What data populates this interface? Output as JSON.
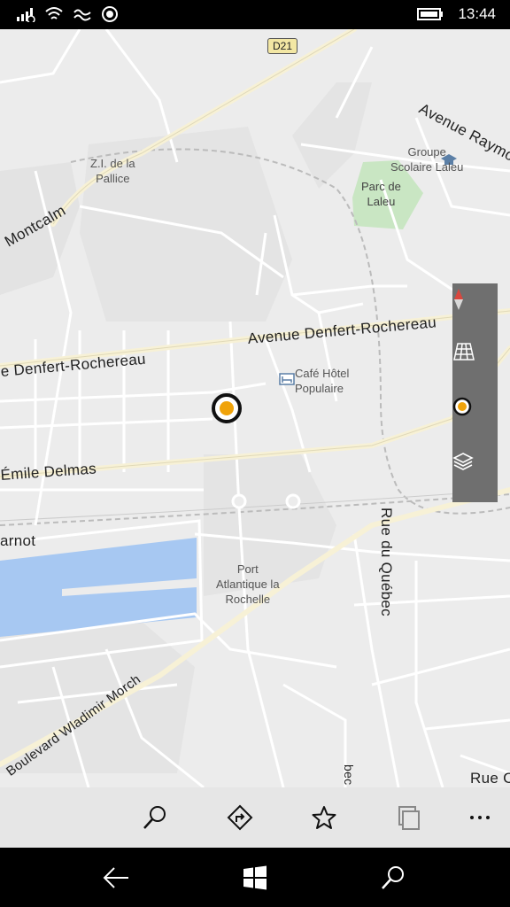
{
  "status_bar": {
    "time": "13:44",
    "icons": [
      "signal-icon",
      "wifi-icon",
      "wifi-calling-icon",
      "location-icon",
      "battery-icon"
    ]
  },
  "map": {
    "route_shield": "D21",
    "area_labels": [
      {
        "id": "zi",
        "text": "Z.I. de la\nPallice"
      },
      {
        "id": "groupe",
        "text": "Groupe\nScolaire Laleu"
      },
      {
        "id": "parc",
        "text": "Parc de\nLaleu"
      },
      {
        "id": "cafe",
        "text": "Café Hôtel\nPopulaire"
      },
      {
        "id": "port",
        "text": "Port\nAtlantique la\nRochelle"
      }
    ],
    "street_labels": {
      "avenue_raymo": "Avenue Raymo",
      "montcalm": "Montcalm",
      "denfert_main": "Avenue  Denfert-Rochereau",
      "denfert_left": "e  Denfert-Rochereau",
      "emile": "Émile  Delmas",
      "carnot": "arnot",
      "rue_quebec": "Rue  du  Québec",
      "boulevard": "Boulevard  Wladimir  Morch",
      "bec": "bec",
      "rue_c": "Rue  C"
    },
    "colors": {
      "land": "#ececec",
      "road": "#ffffff",
      "major_road": "#fbf7e3",
      "water": "#a7c8f2",
      "park": "#c9e6c3",
      "pin": "#f0a30a"
    }
  },
  "map_controls": [
    "compass-icon",
    "3d-buildings-icon",
    "show-location-icon",
    "map-layers-icon"
  ],
  "app_bar": [
    "search-icon",
    "directions-icon",
    "favorites-icon",
    "collections-icon",
    "more-icon"
  ],
  "nav_bar": [
    "back-icon",
    "windows-start-icon",
    "cortana-search-icon"
  ]
}
